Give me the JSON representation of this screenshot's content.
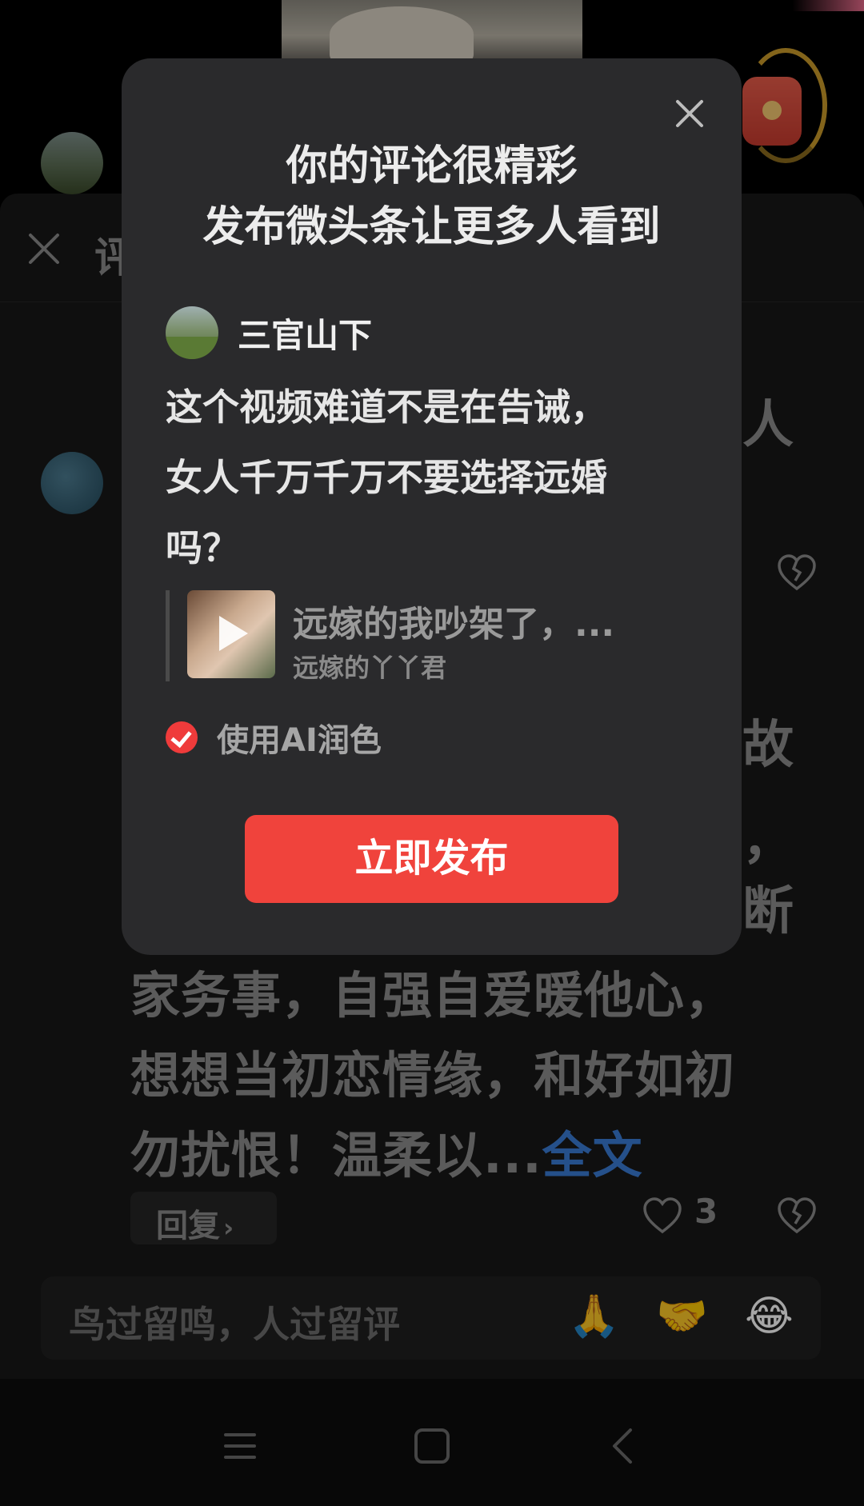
{
  "background": {
    "panel": {
      "title": "评"
    },
    "comment_one": {
      "text_fragment": "人"
    },
    "comment_two": {
      "text_fragment_1": "故",
      "text_fragment_2": "，",
      "text_fragment_3": "断",
      "lines": [
        "家务事，自强自爱暖他心，",
        "想想当初恋情缘，和好如初",
        "勿扰恨！温柔以..."
      ],
      "expand_link": "全文",
      "reply_label": "回复",
      "like_count": "3"
    },
    "input": {
      "placeholder": "鸟过留鸣，人过留评",
      "emojis": [
        "🙏",
        "🤝",
        "😂"
      ]
    }
  },
  "modal": {
    "title_line1": "你的评论很精彩",
    "title_line2": "发布微头条让更多人看到",
    "author_name": "三官山下",
    "comment_lines": [
      "这个视频难道不是在告诫，",
      "女人千万千万不要选择远婚",
      "吗？"
    ],
    "quote": {
      "title": "远嫁的我吵架了，...",
      "subtitle": "远嫁的丫丫君"
    },
    "ai_option": {
      "label": "使用AI润色",
      "checked": true
    },
    "publish_label": "立即发布"
  },
  "colors": {
    "accent": "#f0433c",
    "link": "#3a7bd5",
    "modal_bg": "#2a2a2c"
  }
}
